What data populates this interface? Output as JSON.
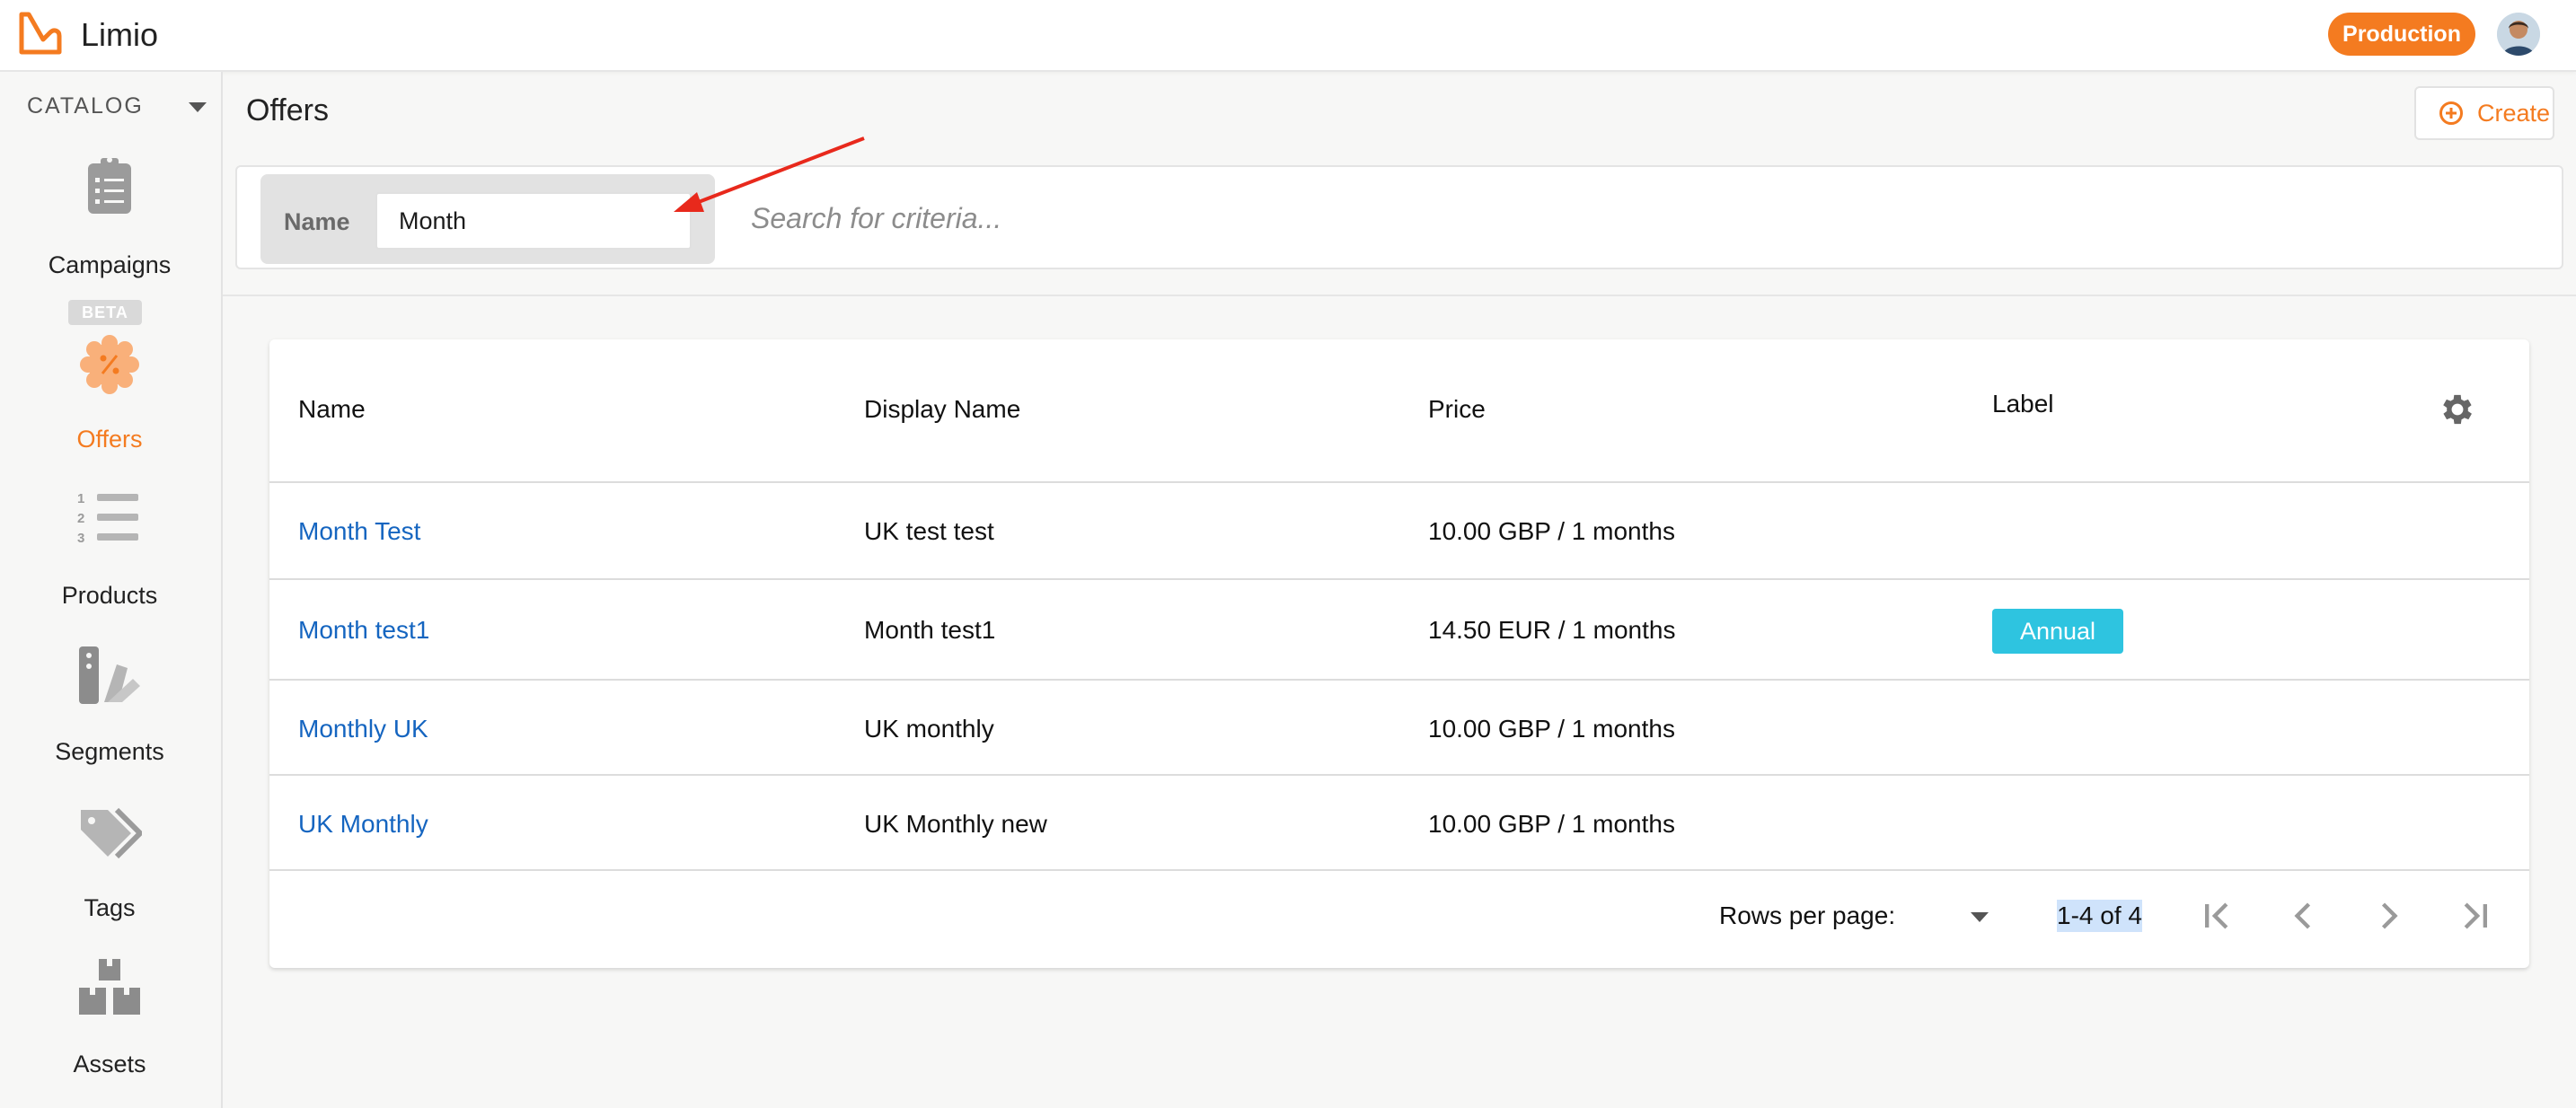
{
  "app": {
    "name": "Limio",
    "environment": "Production"
  },
  "colors": {
    "brand": "#f47b20",
    "link": "#1565c0",
    "label_badge": "#2ec4e0"
  },
  "sidebar": {
    "section": "CATALOG",
    "beta_tag": "BETA",
    "items": [
      {
        "label": "Campaigns",
        "icon": "clipboard-icon",
        "active": false
      },
      {
        "label": "Offers",
        "icon": "discount-badge-icon",
        "active": true
      },
      {
        "label": "Products",
        "icon": "numbered-list-icon",
        "active": false
      },
      {
        "label": "Segments",
        "icon": "segments-icon",
        "active": false
      },
      {
        "label": "Tags",
        "icon": "tags-icon",
        "active": false
      },
      {
        "label": "Assets",
        "icon": "boxes-icon",
        "active": false
      }
    ]
  },
  "page": {
    "title": "Offers",
    "create_label": "Create"
  },
  "filter": {
    "chip_label": "Name",
    "chip_value": "Month",
    "search_placeholder": "Search for criteria..."
  },
  "table": {
    "columns": [
      "Name",
      "Display Name",
      "Price",
      "Label"
    ],
    "rows": [
      {
        "name": "Month Test",
        "display_name": "UK test test",
        "price": "10.00 GBP / 1 months",
        "label": ""
      },
      {
        "name": "Month test1",
        "display_name": "Month test1",
        "price": "14.50 EUR / 1 months",
        "label": "Annual"
      },
      {
        "name": "Monthly UK",
        "display_name": "UK monthly",
        "price": "10.00 GBP / 1 months",
        "label": ""
      },
      {
        "name": "UK Monthly",
        "display_name": "UK Monthly new",
        "price": "10.00 GBP / 1 months",
        "label": ""
      }
    ]
  },
  "pagination": {
    "rows_per_page_label": "Rows per page:",
    "range": "1-4 of 4"
  }
}
